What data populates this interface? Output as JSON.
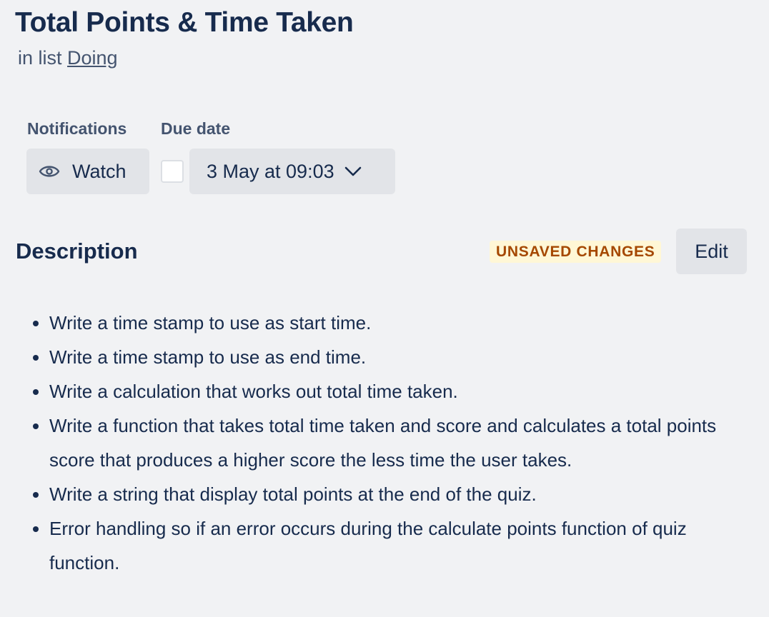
{
  "card": {
    "title": "Total Points & Time Taken",
    "list_prefix": "in list",
    "list_name": "Doing"
  },
  "notifications": {
    "label": "Notifications",
    "watch_label": "Watch",
    "watch_icon": "eye-icon"
  },
  "due_date": {
    "label": "Due date",
    "value": "3 May at 09:03",
    "checked": false,
    "dropdown_icon": "chevron-down-icon"
  },
  "description": {
    "title": "Description",
    "badge": "UNSAVED CHANGES",
    "edit_label": "Edit",
    "items": [
      "Write a time stamp to use as start time.",
      "Write a time stamp to use as end time.",
      "Write a calculation that works out total time taken.",
      "Write a function that takes total time taken and score and calculates a total points score that produces a higher score the less time the user takes.",
      "Write a string that display total points at the end of the quiz.",
      "Error handling so if an error occurs during the calculate points function of quiz function."
    ]
  },
  "colors": {
    "background": "#f1f2f4",
    "text": "#172b4d",
    "subtle_text": "#44546f",
    "button": "#e2e4e8",
    "badge_bg": "#fff7d6",
    "badge_text": "#a54800"
  }
}
